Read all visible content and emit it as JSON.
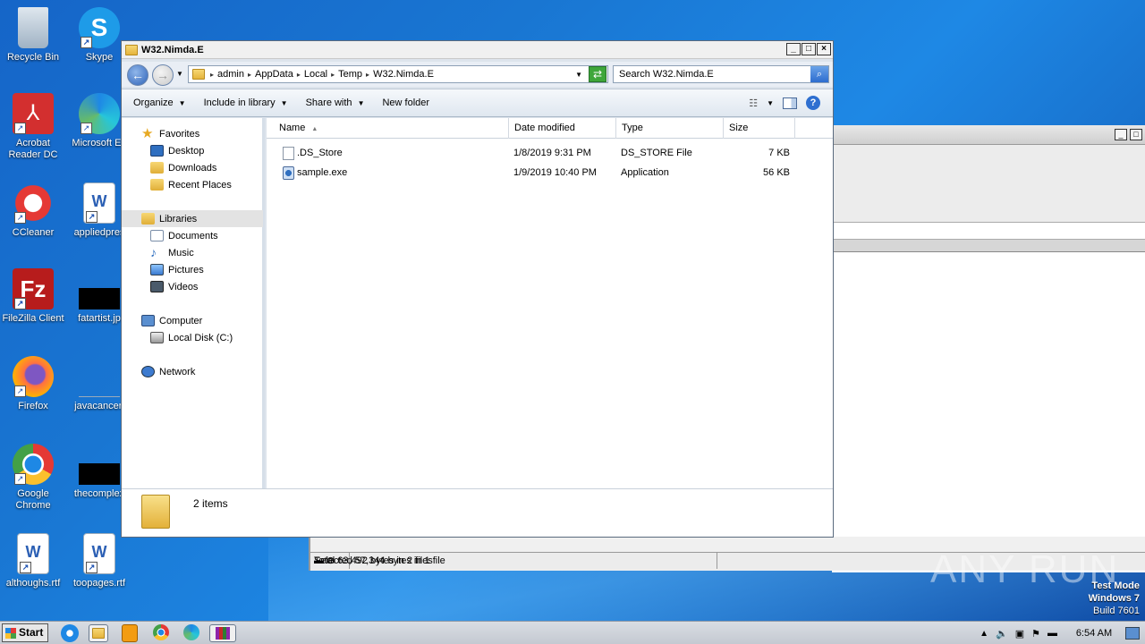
{
  "desktop": {
    "icons": [
      {
        "label": "Recycle Bin",
        "icon": "recycle-bin-icon"
      },
      {
        "label": "Skype",
        "icon": "skype-icon"
      },
      {
        "label": "Acrobat Reader DC",
        "icon": "acrobat-icon"
      },
      {
        "label": "Microsoft Ed",
        "icon": "edge-icon"
      },
      {
        "label": "CCleaner",
        "icon": "ccleaner-icon"
      },
      {
        "label": "appliedpres",
        "icon": "word-doc-icon"
      },
      {
        "label": "FileZilla Client",
        "icon": "filezilla-icon"
      },
      {
        "label": "fatartist.jp",
        "icon": "image-file-icon"
      },
      {
        "label": "Firefox",
        "icon": "firefox-icon"
      },
      {
        "label": "javacancer.",
        "icon": "file-icon"
      },
      {
        "label": "Google Chrome",
        "icon": "chrome-icon"
      },
      {
        "label": "thecomplex",
        "icon": "image-file-icon"
      },
      {
        "label": "althoughs.rtf",
        "icon": "word-doc-icon"
      },
      {
        "label": "toopages.rtf",
        "icon": "word-doc-icon"
      }
    ]
  },
  "explorer": {
    "title": "W32.Nimda.E",
    "breadcrumb": [
      "admin",
      "AppData",
      "Local",
      "Temp",
      "W32.Nimda.E"
    ],
    "search_placeholder": "Search W32.Nimda.E",
    "toolbar": {
      "organize": "Organize",
      "include": "Include in library",
      "share": "Share with",
      "new_folder": "New folder"
    },
    "nav": {
      "favorites": "Favorites",
      "desktop": "Desktop",
      "downloads": "Downloads",
      "recent": "Recent Places",
      "libraries": "Libraries",
      "documents": "Documents",
      "music": "Music",
      "pictures": "Pictures",
      "videos": "Videos",
      "computer": "Computer",
      "local_disk": "Local Disk (C:)",
      "network": "Network"
    },
    "columns": {
      "name": "Name",
      "date": "Date modified",
      "type": "Type",
      "size": "Size"
    },
    "files": [
      {
        "name": ".DS_Store",
        "date": "1/8/2019 9:31 PM",
        "type": "DS_STORE File",
        "size": "7 KB"
      },
      {
        "name": "sample.exe",
        "date": "1/9/2019 10:40 PM",
        "type": "Application",
        "size": "56 KB"
      }
    ],
    "details": "2 items"
  },
  "background_window": {
    "status_selected": "Selected 57,344 bytes in 1 file",
    "status_total": "Total 63,492 bytes in 2 files"
  },
  "watermark": "ANY RUN",
  "testmode": {
    "line1": "Test Mode",
    "line2": "Windows 7",
    "line3": "Build 7601"
  },
  "taskbar": {
    "start": "Start",
    "clock": "6:54 AM"
  }
}
